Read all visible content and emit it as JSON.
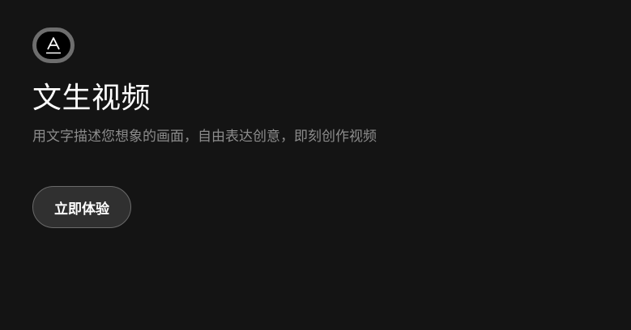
{
  "feature": {
    "icon": "text-to-video-icon",
    "title": "文生视频",
    "description": "用文字描述您想象的画面，自由表达创意，即刻创作视频",
    "cta_label": "立即体验"
  },
  "colors": {
    "background": "#141414",
    "title": "#ffffff",
    "description": "#8c8c8c",
    "button_bg": "#303030",
    "button_border": "#6a6a6a",
    "icon_ring": "#6e6e6e"
  }
}
